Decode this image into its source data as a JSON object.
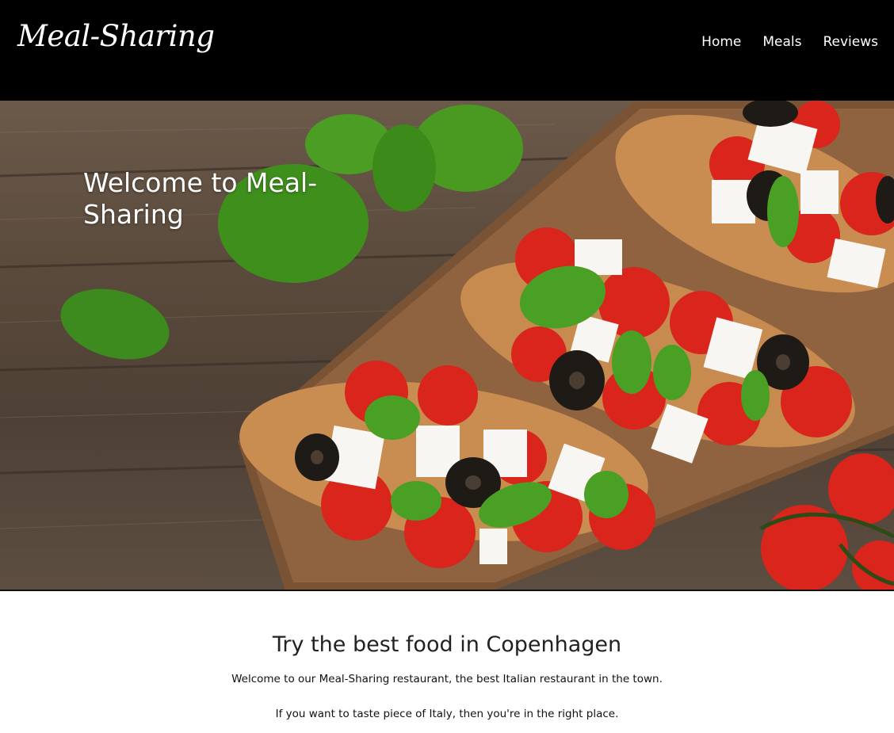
{
  "header": {
    "logo": "Meal-Sharing",
    "nav": [
      {
        "label": "Home"
      },
      {
        "label": "Meals"
      },
      {
        "label": "Reviews"
      }
    ]
  },
  "hero": {
    "title": "Welcome to Meal-Sharing"
  },
  "main": {
    "heading": "Try the best food in Copenhagen",
    "paragraph1": "Welcome to our Meal-Sharing restaurant, the best Italian restaurant in the town.",
    "paragraph2": "If you want to taste piece of Italy, then you're in the right place."
  },
  "colors": {
    "nav_bg": "#000000",
    "nav_text": "#ffffff"
  }
}
